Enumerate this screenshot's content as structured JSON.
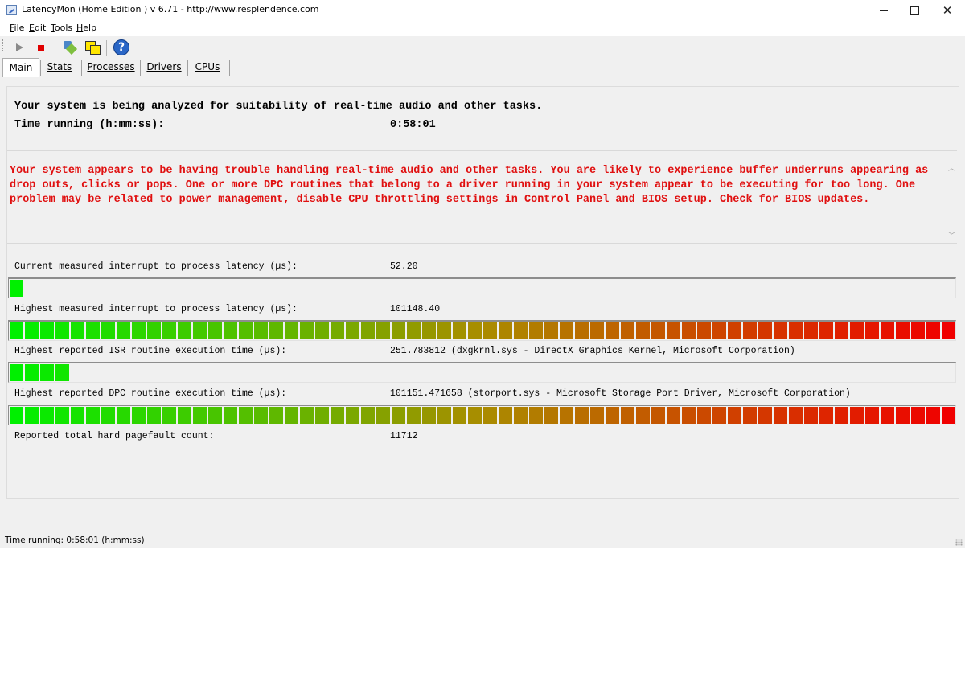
{
  "window": {
    "title": "LatencyMon  (Home Edition )  v 6.71 - http://www.resplendence.com",
    "minimize_glyph": "",
    "maximize_glyph": "",
    "close_glyph": "✕"
  },
  "menu": [
    {
      "hot": "F",
      "rest": "ile"
    },
    {
      "hot": "E",
      "rest": "dit"
    },
    {
      "hot": "T",
      "rest": "ools"
    },
    {
      "hot": "H",
      "rest": "elp"
    }
  ],
  "toolbar": {
    "icons": [
      "play-icon",
      "stop-icon",
      "tools-icon",
      "windows-icon",
      "help-icon"
    ],
    "help_glyph": "?"
  },
  "tabs": [
    {
      "label": "Main",
      "active": true
    },
    {
      "label": "Stats",
      "active": false
    },
    {
      "label": "Processes",
      "active": false
    },
    {
      "label": "Drivers",
      "active": false
    },
    {
      "label": "CPUs",
      "active": false
    }
  ],
  "main": {
    "analyzing": "Your system is being analyzed for suitability of real-time audio and other tasks.",
    "time_running_label": "Time running (h:mm:ss):",
    "time_running_value": "0:58:01",
    "warning": "Your system appears to be having trouble handling real-time audio and other tasks. You are likely to experience buffer underruns appearing as drop outs, clicks or pops. One or more DPC routines that belong to a driver running in your system appear to be executing for too long. One problem may be related to power management, disable CPU throttling settings in Control Panel and BIOS setup. Check for BIOS updates."
  },
  "metrics": {
    "current_latency": {
      "label": "Current measured interrupt to process latency (µs):",
      "value": "52.20",
      "level_fraction": 0.015
    },
    "highest_latency": {
      "label": "Highest measured interrupt to process latency (µs):",
      "value": "101148.40",
      "level_fraction": 1.0
    },
    "isr": {
      "label": "Highest reported ISR routine execution time (µs):",
      "value": "251.783812   (dxgkrnl.sys - DirectX Graphics Kernel, Microsoft Corporation)",
      "level_fraction": 0.066
    },
    "dpc": {
      "label": "Highest reported DPC routine execution time (µs):",
      "value": "101151.471658   (storport.sys - Microsoft Storage Port Driver, Microsoft Corporation)",
      "level_fraction": 1.0
    },
    "pagefaults": {
      "label": "Reported total hard pagefault count:",
      "value": "11712"
    }
  },
  "colors": {
    "gradient_start": "#00f000",
    "gradient_end": "#f00000",
    "warning_text": "#e01010"
  },
  "statusbar": {
    "text": "Time running: 0:58:01  (h:mm:ss)"
  }
}
